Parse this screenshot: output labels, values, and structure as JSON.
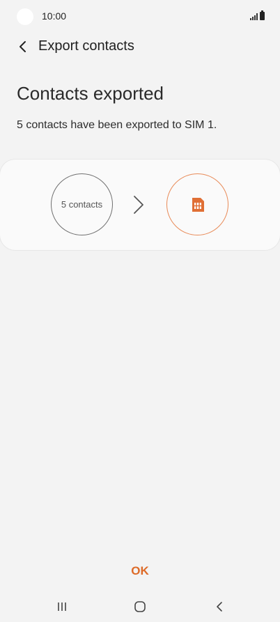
{
  "status_bar": {
    "time": "10:00"
  },
  "app_bar": {
    "title": "Export contacts",
    "back_icon": "chevron-left-icon"
  },
  "content": {
    "heading": "Contacts exported",
    "message": "5 contacts have been exported to SIM 1."
  },
  "transfer_card": {
    "source_label": "5 contacts",
    "arrow_icon": "chevron-right-icon",
    "destination_icon": "sim-card-icon"
  },
  "actions": {
    "ok_label": "OK"
  },
  "nav_bar": {
    "recents_icon": "recents-icon",
    "home_icon": "home-icon",
    "back_icon": "back-icon"
  },
  "colors": {
    "accent": "#dd6a27",
    "background": "#f3f3f3",
    "card": "#fafafa"
  }
}
